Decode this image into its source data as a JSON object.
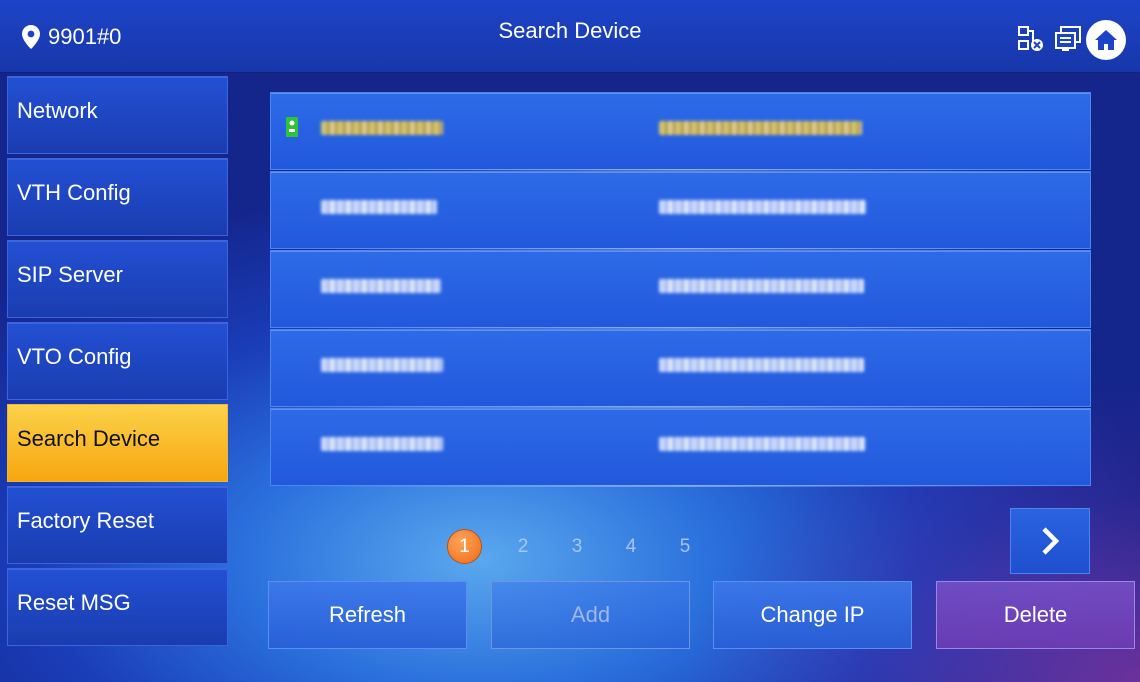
{
  "header": {
    "location": "9901#0",
    "title": "Search Device",
    "icons": [
      "location-pin-icon",
      "network-disconnect-icon",
      "copy-screens-icon",
      "home-icon"
    ]
  },
  "sidebar": {
    "items": [
      {
        "label": "Network",
        "active": false
      },
      {
        "label": "VTH Config",
        "active": false
      },
      {
        "label": "SIP Server",
        "active": false
      },
      {
        "label": "VTO Config",
        "active": false
      },
      {
        "label": "Search Device",
        "active": true
      },
      {
        "label": "Factory Reset",
        "active": false
      },
      {
        "label": "Reset MSG",
        "active": false
      }
    ]
  },
  "device_list": {
    "rows": [
      {
        "selected": true
      },
      {
        "selected": false
      },
      {
        "selected": false
      },
      {
        "selected": false
      },
      {
        "selected": false
      }
    ]
  },
  "pagination": {
    "pages": [
      "1",
      "2",
      "3",
      "4",
      "5"
    ],
    "current": "1",
    "next_icon": "chevron-right-icon"
  },
  "actions": {
    "refresh": "Refresh",
    "add": "Add",
    "change_ip": "Change IP",
    "delete": "Delete"
  },
  "colors": {
    "accent_active": "#f6a60f",
    "page_active": "#f06a14",
    "header": "#1d44c8"
  }
}
